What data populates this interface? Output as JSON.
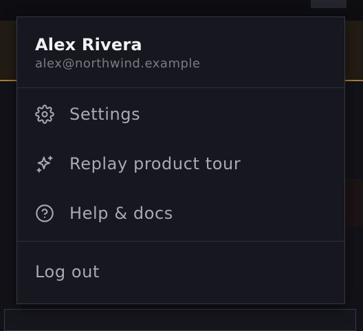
{
  "user": {
    "name": "Alex Rivera",
    "email": "alex@northwind.example"
  },
  "menu": {
    "items": [
      {
        "label": "Settings",
        "icon": "gear-icon"
      },
      {
        "label": "Replay product tour",
        "icon": "sparkles-icon"
      },
      {
        "label": "Help & docs",
        "icon": "help-circle-icon"
      }
    ],
    "logout_label": "Log out"
  },
  "colors": {
    "menu_background": "#17171f",
    "menu_border": "#393945",
    "name_text": "#f1f1f4",
    "email_text": "#7b7b86",
    "item_text": "#a9a9b3",
    "banner_accent": "#a9842b"
  }
}
